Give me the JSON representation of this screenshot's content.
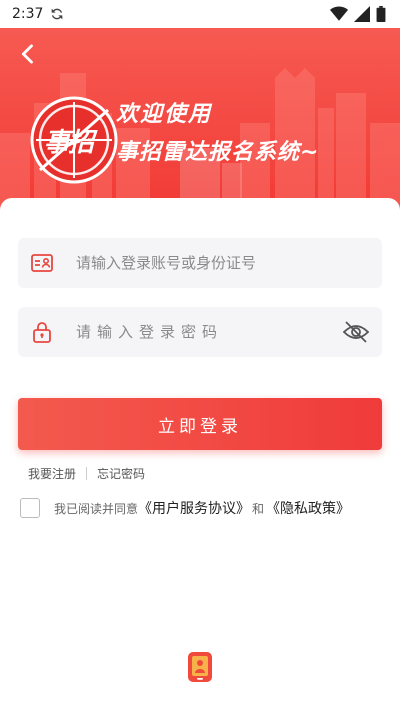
{
  "status_bar": {
    "time": "2:37",
    "sync_icon": "sync-icon",
    "wifi_icon": "wifi-icon",
    "signal_icon": "signal-icon",
    "battery_icon": "battery-icon"
  },
  "header": {
    "back_icon": "back-arrow-icon",
    "logo_text": "事招",
    "welcome_line1": "欢迎使用",
    "welcome_line2": "事招雷达报名系统~"
  },
  "form": {
    "account": {
      "placeholder": "请输入登录账号或身份证号",
      "icon": "id-card-icon"
    },
    "password": {
      "placeholder": "请输入登录密码",
      "icon": "lock-icon",
      "toggle_icon": "eye-off-icon"
    },
    "login_label": "立即登录",
    "register_link": "我要注册",
    "forgot_link": "忘记密码"
  },
  "agreement": {
    "prefix": "我已阅读并同意",
    "user_agreement": "《用户服务协议》",
    "conjunction": "和",
    "privacy_policy": "《隐私政策》"
  },
  "colors": {
    "primary": "#f23a35",
    "field_bg": "#f5f5f7"
  }
}
